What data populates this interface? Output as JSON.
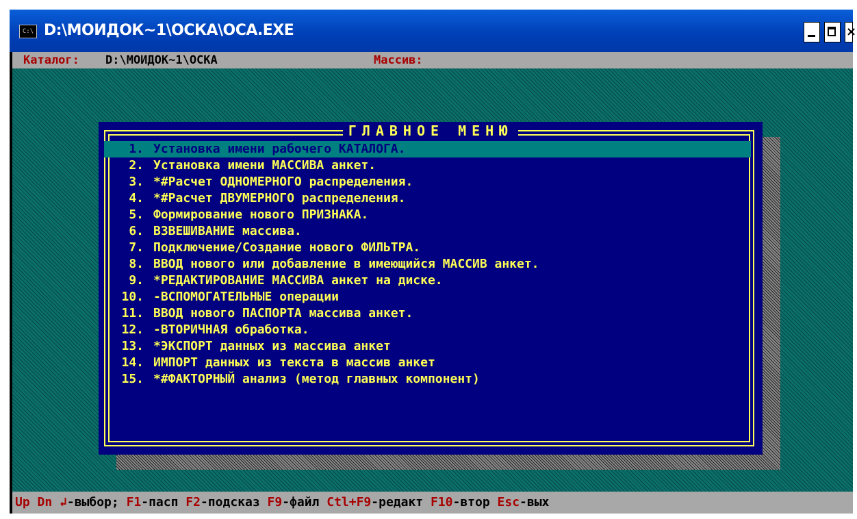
{
  "window": {
    "title": "D:\\МОИДОК~1\\ОСКА\\ОСА.EXE",
    "icon_text": "C:\\",
    "min_label": "minimize",
    "max_label": "maximize",
    "close_label": "×"
  },
  "topbar": {
    "catalog_label": "Каталог:",
    "catalog_value": "D:\\МОИДОК~1\\ОСКА",
    "array_label": "Массив:"
  },
  "menu": {
    "title": "ГЛАВНОЕ МЕНЮ",
    "selected_index": 0,
    "items": [
      {
        "num": "1.",
        "label": "Установка имени рабочего КАТАЛОГА."
      },
      {
        "num": "2.",
        "label": "Установка имени МАССИВА анкет."
      },
      {
        "num": "3.",
        "label": "*#Расчет ОДНОМЕРНОГО распределения."
      },
      {
        "num": "4.",
        "label": "*#Расчет ДВУМЕРНОГО распределения."
      },
      {
        "num": "5.",
        "label": "Формирование нового ПРИЗНАКА."
      },
      {
        "num": "6.",
        "label": "ВЗВЕШИВАНИЕ массива."
      },
      {
        "num": "7.",
        "label": "Подключение/Создание нового ФИЛЬТРА."
      },
      {
        "num": "8.",
        "label": "ВВОД нового или добавление в имеющийся МАССИВ анкет."
      },
      {
        "num": "9.",
        "label": "*РЕДАКТИРОВАНИЕ МАССИВА анкет на диске."
      },
      {
        "num": "10.",
        "label": "-ВСПОМОГАТЕЛЬНЫЕ операции"
      },
      {
        "num": "11.",
        "label": "ВВОД нового ПАСПОРТА массива анкет."
      },
      {
        "num": "12.",
        "label": "-ВТОРИЧНАЯ обработка."
      },
      {
        "num": "13.",
        "label": "*ЭКСПОРТ данных из массива анкет"
      },
      {
        "num": "14.",
        "label": "ИМПОРТ данных из текста в массив анкет"
      },
      {
        "num": "15.",
        "label": "*#ФАКТОРНЫЙ анализ (метод главных компонент)"
      }
    ]
  },
  "statusbar": {
    "keys": [
      {
        "key": "Up Dn ↲",
        "desc": "-выбор; "
      },
      {
        "key": "F1",
        "desc": "-пасп "
      },
      {
        "key": "F2",
        "desc": "-подсказ "
      },
      {
        "key": "F9",
        "desc": "-файл "
      },
      {
        "key": "Ctl+F9",
        "desc": "-редакт "
      },
      {
        "key": "F10",
        "desc": "-втор "
      },
      {
        "key": "Esc",
        "desc": "-вых"
      }
    ]
  },
  "colors": {
    "titlebar": "#0040b8",
    "menu_bg": "#000080",
    "menu_text": "#ffff55",
    "selection": "#008080",
    "desktop": "#0b6f6a",
    "bar_gray": "#a8a8a8",
    "key_red": "#a80000"
  }
}
